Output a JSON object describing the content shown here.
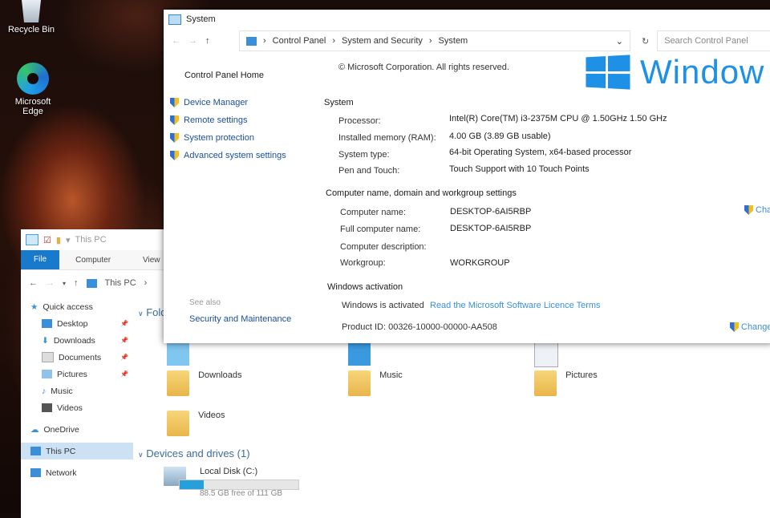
{
  "desktop": {
    "icons": [
      {
        "label": "Recycle Bin",
        "icon": "recycle-bin-icon"
      },
      {
        "label": "Microsoft Edge",
        "icon": "edge-icon"
      }
    ]
  },
  "explorer": {
    "title": "This PC",
    "ribbon_tabs": [
      "File",
      "Computer",
      "View"
    ],
    "address": "This PC",
    "nav": {
      "quick_access": "Quick access",
      "items": [
        "Desktop",
        "Downloads",
        "Documents",
        "Pictures",
        "Music",
        "Videos"
      ],
      "onedrive": "OneDrive",
      "this_pc": "This PC",
      "network": "Network"
    },
    "folders_heading": "Folde",
    "folders": [
      "Downloads",
      "Music",
      "Pictures",
      "Videos"
    ],
    "devices_heading": "Devices and drives (1)",
    "drive": {
      "name": "Local Disk (C:)",
      "free_text": "88.5 GB free of 111 GB",
      "used_fraction": 0.2
    }
  },
  "system": {
    "window_title": "System",
    "breadcrumb": [
      "Control Panel",
      "System and Security",
      "System"
    ],
    "search_placeholder": "Search Control Panel",
    "sidebar": {
      "home": "Control Panel Home",
      "links": [
        "Device Manager",
        "Remote settings",
        "System protection",
        "Advanced system settings"
      ],
      "see_also": "See also",
      "see_also_link": "Security and Maintenance"
    },
    "copyright": "© Microsoft Corporation. All rights reserved.",
    "logo_text": "Window",
    "system_section": {
      "heading": "System",
      "rows": [
        {
          "label": "Processor:",
          "value": "Intel(R) Core(TM) i3-2375M CPU @ 1.50GHz   1.50 GHz"
        },
        {
          "label": "Installed memory (RAM):",
          "value": "4.00 GB (3.89 GB usable)"
        },
        {
          "label": "System type:",
          "value": "64-bit Operating System, x64-based processor"
        },
        {
          "label": "Pen and Touch:",
          "value": "Touch Support with 10 Touch Points"
        }
      ]
    },
    "computer_section": {
      "heading": "Computer name, domain and workgroup settings",
      "rows": [
        {
          "label": "Computer name:",
          "value": "DESKTOP-6AI5RBP"
        },
        {
          "label": "Full computer name:",
          "value": "DESKTOP-6AI5RBP"
        },
        {
          "label": "Computer description:",
          "value": ""
        },
        {
          "label": "Workgroup:",
          "value": "WORKGROUP"
        }
      ],
      "change_link": "Cha"
    },
    "activation_section": {
      "heading": "Windows activation",
      "status": "Windows is activated",
      "licence_link": "Read the Microsoft Software Licence Terms",
      "product_id": "Product ID:  00326-10000-00000-AA508",
      "change_link": "Change"
    }
  }
}
